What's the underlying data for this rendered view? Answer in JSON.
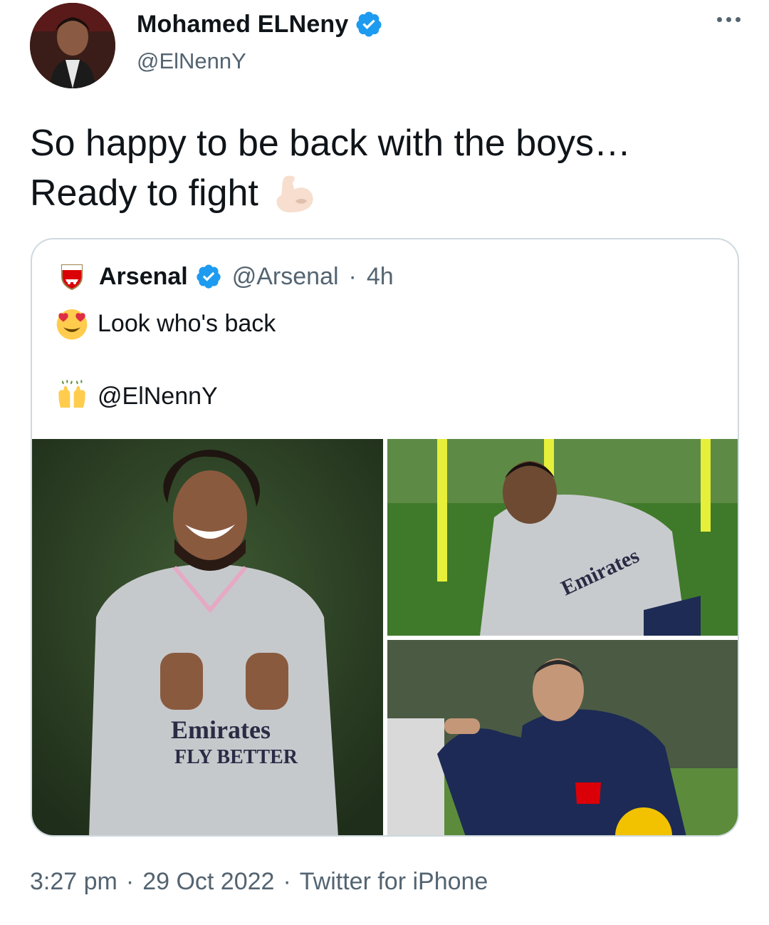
{
  "author": {
    "display_name": "Mohamed ELNeny",
    "handle": "@ElNennY",
    "avatar_icon": "profile-photo",
    "verified_color": "#1d9bf0"
  },
  "tweet": {
    "text_line1": "So happy to be back with the boys…",
    "text_line2": "Ready to fight",
    "emoji": "flexed-biceps"
  },
  "quoted_tweet": {
    "display_name": "Arsenal",
    "handle": "@Arsenal",
    "separator": "·",
    "time": "4h",
    "line1_emoji": "heart-eyes",
    "line1_text": "Look who's back",
    "line2_emoji": "raising-hands",
    "line2_text": "@ElNennY",
    "photos": [
      "player-smiling-pointing",
      "player-running-training",
      "coach-pointing"
    ]
  },
  "footer": {
    "time": "3:27 pm",
    "dot1": "·",
    "date": "29 Oct 2022",
    "dot2": "·",
    "source": "Twitter for iPhone"
  }
}
